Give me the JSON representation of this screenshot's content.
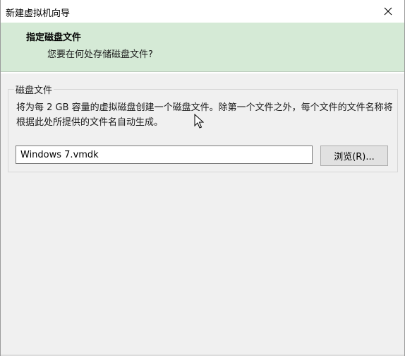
{
  "window": {
    "title": "新建虚拟机向导"
  },
  "header": {
    "title": "指定磁盘文件",
    "subtitle": "您要在何处存储磁盘文件?"
  },
  "disk_group": {
    "label": "磁盘文件",
    "description": "将为每 2 GB 容量的虚拟磁盘创建一个磁盘文件。除第一个文件之外，每个文件的文件名称将根据此处所提供的文件名自动生成。",
    "file_value": "Windows 7.vmdk",
    "browse_label": "浏览(R)..."
  },
  "icons": {
    "close": "close-icon",
    "cursor": "mouse-pointer-icon"
  },
  "colors": {
    "header_bg": "#d5ead6",
    "window_bg": "#f0f0f0"
  }
}
